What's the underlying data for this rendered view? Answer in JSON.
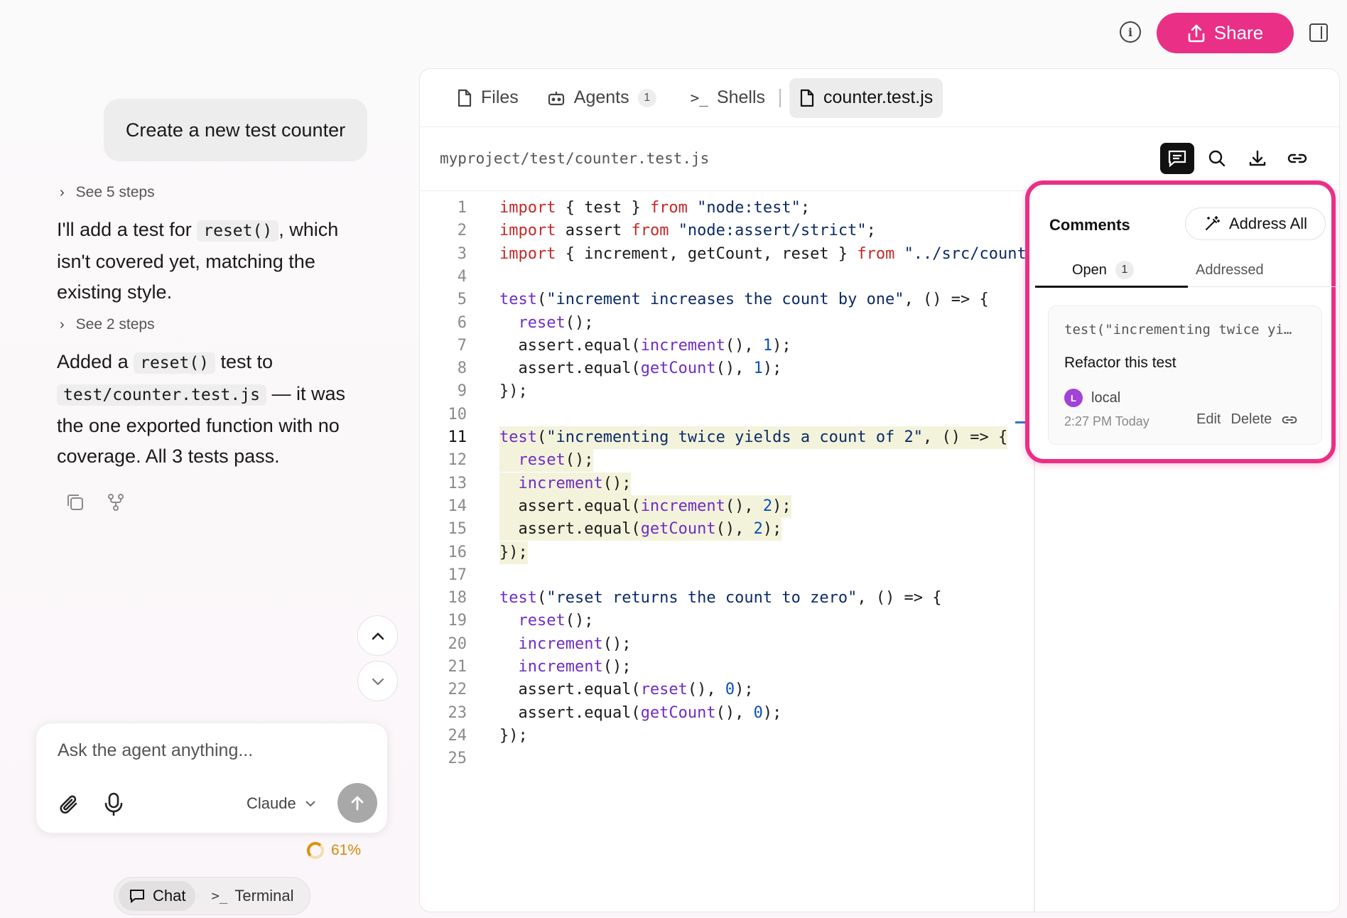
{
  "header": {
    "share_label": "Share"
  },
  "chat": {
    "user_message": "Create a new test counter",
    "steps_1": "See 5 steps",
    "steps_2": "See 2 steps",
    "reply_1": {
      "before": "I'll add a test for ",
      "code": "reset()",
      "after": ", which isn't covered yet, matching the existing style."
    },
    "reply_2": {
      "before": "Added a ",
      "code1": "reset()",
      "middle": " test to ",
      "code2": "test/counter.test.js",
      "after": " — it was the one exported function with no coverage. All 3 tests pass."
    },
    "composer": {
      "placeholder": "Ask the agent anything...",
      "model": "Claude"
    },
    "progress_label": "61%",
    "modes": [
      "Chat",
      "Terminal"
    ]
  },
  "editor": {
    "tabs": [
      {
        "label": "Files"
      },
      {
        "label": "Agents",
        "badge": "1"
      },
      {
        "label": "Shells"
      },
      {
        "label": "counter.test.js"
      }
    ],
    "path": "myproject/test/counter.test.js",
    "current_line": "11",
    "lines": [
      "import { test } from \"node:test\";",
      "import assert from \"node:assert/strict\";",
      "import { increment, getCount, reset } from \"../src/counter",
      "",
      "test(\"increment increases the count by one\", () => {",
      "  reset();",
      "  assert.equal(increment(), 1);",
      "  assert.equal(getCount(), 1);",
      "});",
      "",
      "test(\"incrementing twice yields a count of 2\", () => {",
      "  reset();",
      "  increment();",
      "  assert.equal(increment(), 2);",
      "  assert.equal(getCount(), 2);",
      "});",
      "",
      "test(\"reset returns the count to zero\", () => {",
      "  reset();",
      "  increment();",
      "  increment();",
      "  assert.equal(reset(), 0);",
      "  assert.equal(getCount(), 0);",
      "});",
      ""
    ]
  },
  "comments": {
    "title": "Comments",
    "address_all": "Address All",
    "tab_open": "Open",
    "tab_open_count": "1",
    "tab_addressed": "Addressed",
    "card": {
      "snippet": "test(\"incrementing twice yi…",
      "body": "Refactor this test",
      "avatar_letter": "L",
      "author": "local",
      "time": "2:27 PM Today",
      "edit": "Edit",
      "delete": "Delete"
    }
  },
  "colors": {
    "accent": "#ea2f87",
    "keyword": "#c62828",
    "string": "#0b2b66",
    "function": "#6f2cc4",
    "number": "#0b4fb6",
    "highlight": "#f3f3dc"
  }
}
